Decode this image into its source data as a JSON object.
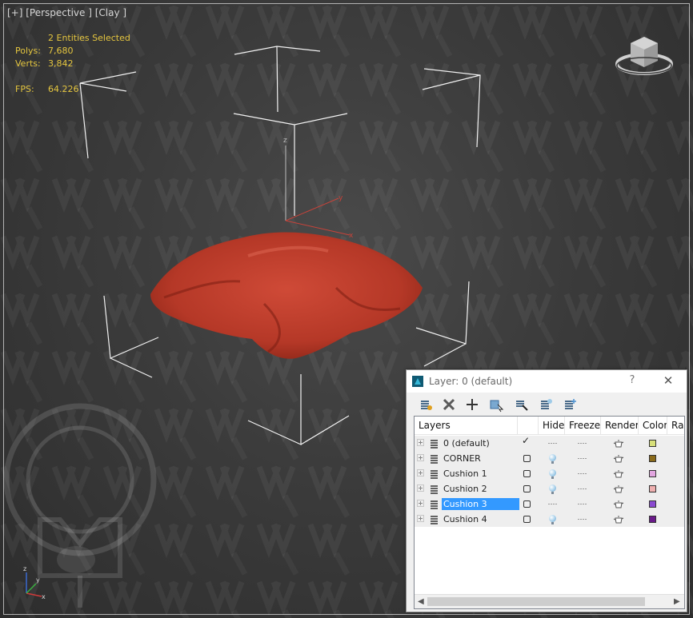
{
  "viewport": {
    "label": "[+] [Perspective ] [Clay ]",
    "selection": "2 Entities Selected",
    "polys_label": "Polys:",
    "polys_value": "7,680",
    "verts_label": "Verts:",
    "verts_value": "3,842",
    "fps_label": "FPS:",
    "fps_value": "64.226",
    "axis_z": "z",
    "axis_y": "y",
    "axis_x": "x",
    "object_color": "#c2402f",
    "stats_color": "#e5c63f"
  },
  "layer_dialog": {
    "title": "Layer: 0 (default)",
    "help_label": "?",
    "close_label": "✕",
    "toolbar_icons": [
      "create-layer-icon",
      "delete-layer-icon",
      "add-to-layer-icon",
      "select-objects-icon",
      "highlight-layer-icon",
      "hide-all-icon",
      "freeze-all-icon"
    ],
    "columns": [
      "Layers",
      "",
      "Hide",
      "Freeze",
      "Render",
      "Color",
      "Ra"
    ],
    "layers": [
      {
        "name": "0 (default)",
        "active": true,
        "hidden": false,
        "color": "#d8e07a"
      },
      {
        "name": "CORNER",
        "active": false,
        "hidden": false,
        "color": "#8a6a1a"
      },
      {
        "name": "Cushion 1",
        "active": false,
        "hidden": false,
        "color": "#e2a6e0"
      },
      {
        "name": "Cushion 2",
        "active": false,
        "hidden": false,
        "color": "#efb0b0"
      },
      {
        "name": "Cushion 3",
        "active": false,
        "hidden": true,
        "selected": true,
        "color": "#8a4ad0"
      },
      {
        "name": "Cushion 4",
        "active": false,
        "hidden": false,
        "color": "#6a1a8a"
      }
    ]
  }
}
